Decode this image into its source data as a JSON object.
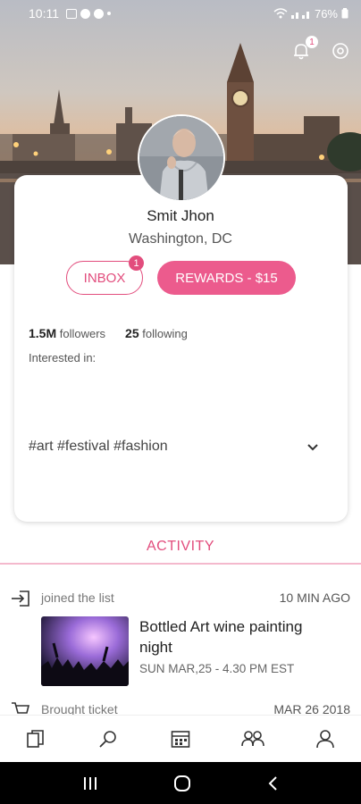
{
  "status_bar": {
    "time": "10:11",
    "battery": "76%"
  },
  "header": {
    "notification_count": "1"
  },
  "profile": {
    "name": "Smit Jhon",
    "location": "Washington, DC",
    "inbox_label": "INBOX",
    "inbox_badge": "1",
    "rewards_label": "REWARDS - $15",
    "followers_count": "1.5M",
    "followers_label": "followers",
    "following_count": "25",
    "following_label": "following",
    "interested_label": "Interested in:",
    "tags": "#art #festival #fashion"
  },
  "activity": {
    "title": "ACTIVITY",
    "items": [
      {
        "icon": "login-icon",
        "action": "joined the list",
        "time": "10 MIN AGO",
        "event_title": "Bottled Art wine painting night",
        "event_date": "SUN MAR,25 - 4.30 PM EST"
      },
      {
        "icon": "cart-icon",
        "action": "Brought ticket",
        "time": "MAR 26 2018"
      }
    ]
  },
  "bottom_nav": [
    "copy-icon",
    "search-icon",
    "calendar-icon",
    "people-icon",
    "profile-icon"
  ],
  "colors": {
    "accent": "#e24d7d",
    "rewards_bg": "#ec5b8d"
  }
}
